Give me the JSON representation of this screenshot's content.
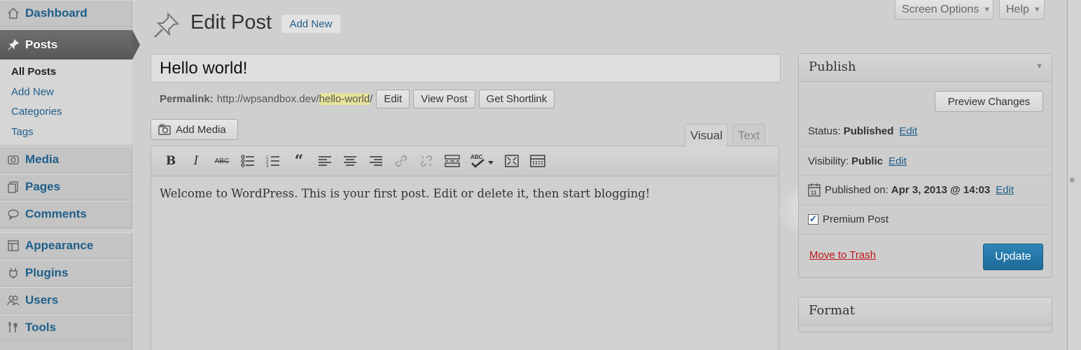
{
  "sidebar": {
    "items": [
      {
        "label": "Dashboard",
        "icon": "home-icon"
      },
      {
        "label": "Posts",
        "icon": "pin-icon"
      },
      {
        "label": "Media",
        "icon": "media-icon"
      },
      {
        "label": "Pages",
        "icon": "pages-icon"
      },
      {
        "label": "Comments",
        "icon": "comments-icon"
      },
      {
        "label": "Appearance",
        "icon": "appearance-icon"
      },
      {
        "label": "Plugins",
        "icon": "plugins-icon"
      },
      {
        "label": "Users",
        "icon": "users-icon"
      },
      {
        "label": "Tools",
        "icon": "tools-icon"
      }
    ],
    "submenu": [
      "All Posts",
      "Add New",
      "Categories",
      "Tags"
    ]
  },
  "header": {
    "title": "Edit Post",
    "add_new": "Add New",
    "screen_options": "Screen Options",
    "help": "Help"
  },
  "post": {
    "title": "Hello world!",
    "permalink_label": "Permalink:",
    "permalink_base": "http://wpsandbox.dev/",
    "permalink_slug": "hello-world",
    "permalink_trail": "/",
    "edit_btn": "Edit",
    "view_btn": "View Post",
    "shortlink_btn": "Get Shortlink"
  },
  "editor": {
    "add_media": "Add Media",
    "tab_visual": "Visual",
    "tab_text": "Text",
    "content": "Welcome to WordPress. This is your first post. Edit or delete it, then start blogging!"
  },
  "publish": {
    "heading": "Publish",
    "preview": "Preview Changes",
    "status_label": "Status:",
    "status_value": "Published",
    "visibility_label": "Visibility:",
    "visibility_value": "Public",
    "published_label": "Published on:",
    "published_value": "Apr 3, 2013 @ 14:03",
    "edit_link": "Edit",
    "premium_label": "Premium Post",
    "premium_checked": true,
    "trash": "Move to Trash",
    "update": "Update"
  },
  "format": {
    "heading": "Format"
  },
  "colors": {
    "link": "#1f5f8a",
    "primary_button": "#2576a7",
    "trash": "#c0161a",
    "slug_highlight": "#e8e39a"
  }
}
